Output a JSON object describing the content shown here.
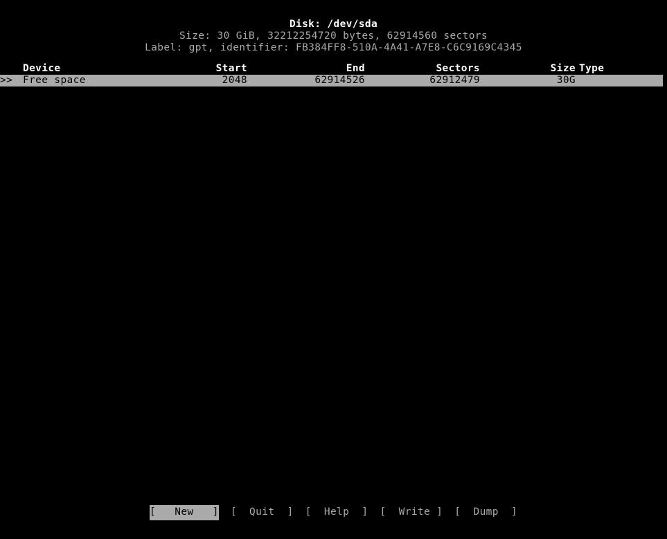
{
  "app": {
    "name": "cfdisk"
  },
  "header": {
    "disk_title": "Disk: /dev/sda",
    "size_line": "Size: 30 GiB, 32212254720 bytes, 62914560 sectors",
    "label_line": "Label: gpt, identifier: FB384FF8-510A-4A41-A7E8-C6C9169C4345",
    "disk_path": "/dev/sda",
    "size_human": "30 GiB",
    "size_bytes": "32212254720",
    "size_sectors": "62914560",
    "label_type": "gpt",
    "identifier": "FB384FF8-510A-4A41-A7E8-C6C9169C4345"
  },
  "table": {
    "columns": {
      "marker": "",
      "device": "Device",
      "start": "Start",
      "end": "End",
      "sectors": "Sectors",
      "size": "Size",
      "type": "Type"
    },
    "rows": [
      {
        "marker": ">>",
        "device": "Free space",
        "start": "2048",
        "end": "62914526",
        "sectors": "62912479",
        "size": "30G",
        "type": "",
        "selected": true
      }
    ]
  },
  "menu": {
    "buttons": [
      {
        "label": "[   New   ]",
        "name": "new",
        "selected": true
      },
      {
        "label": "[  Quit  ]",
        "name": "quit",
        "selected": false
      },
      {
        "label": "[  Help  ]",
        "name": "help",
        "selected": false
      },
      {
        "label": "[  Write ]",
        "name": "write",
        "selected": false
      },
      {
        "label": "[  Dump  ]",
        "name": "dump",
        "selected": false
      }
    ]
  },
  "colors": {
    "background": "#000000",
    "foreground": "#aaaaaa",
    "bright_foreground": "#ffffff",
    "highlight_background": "#aaaaaa",
    "highlight_foreground": "#000000"
  }
}
